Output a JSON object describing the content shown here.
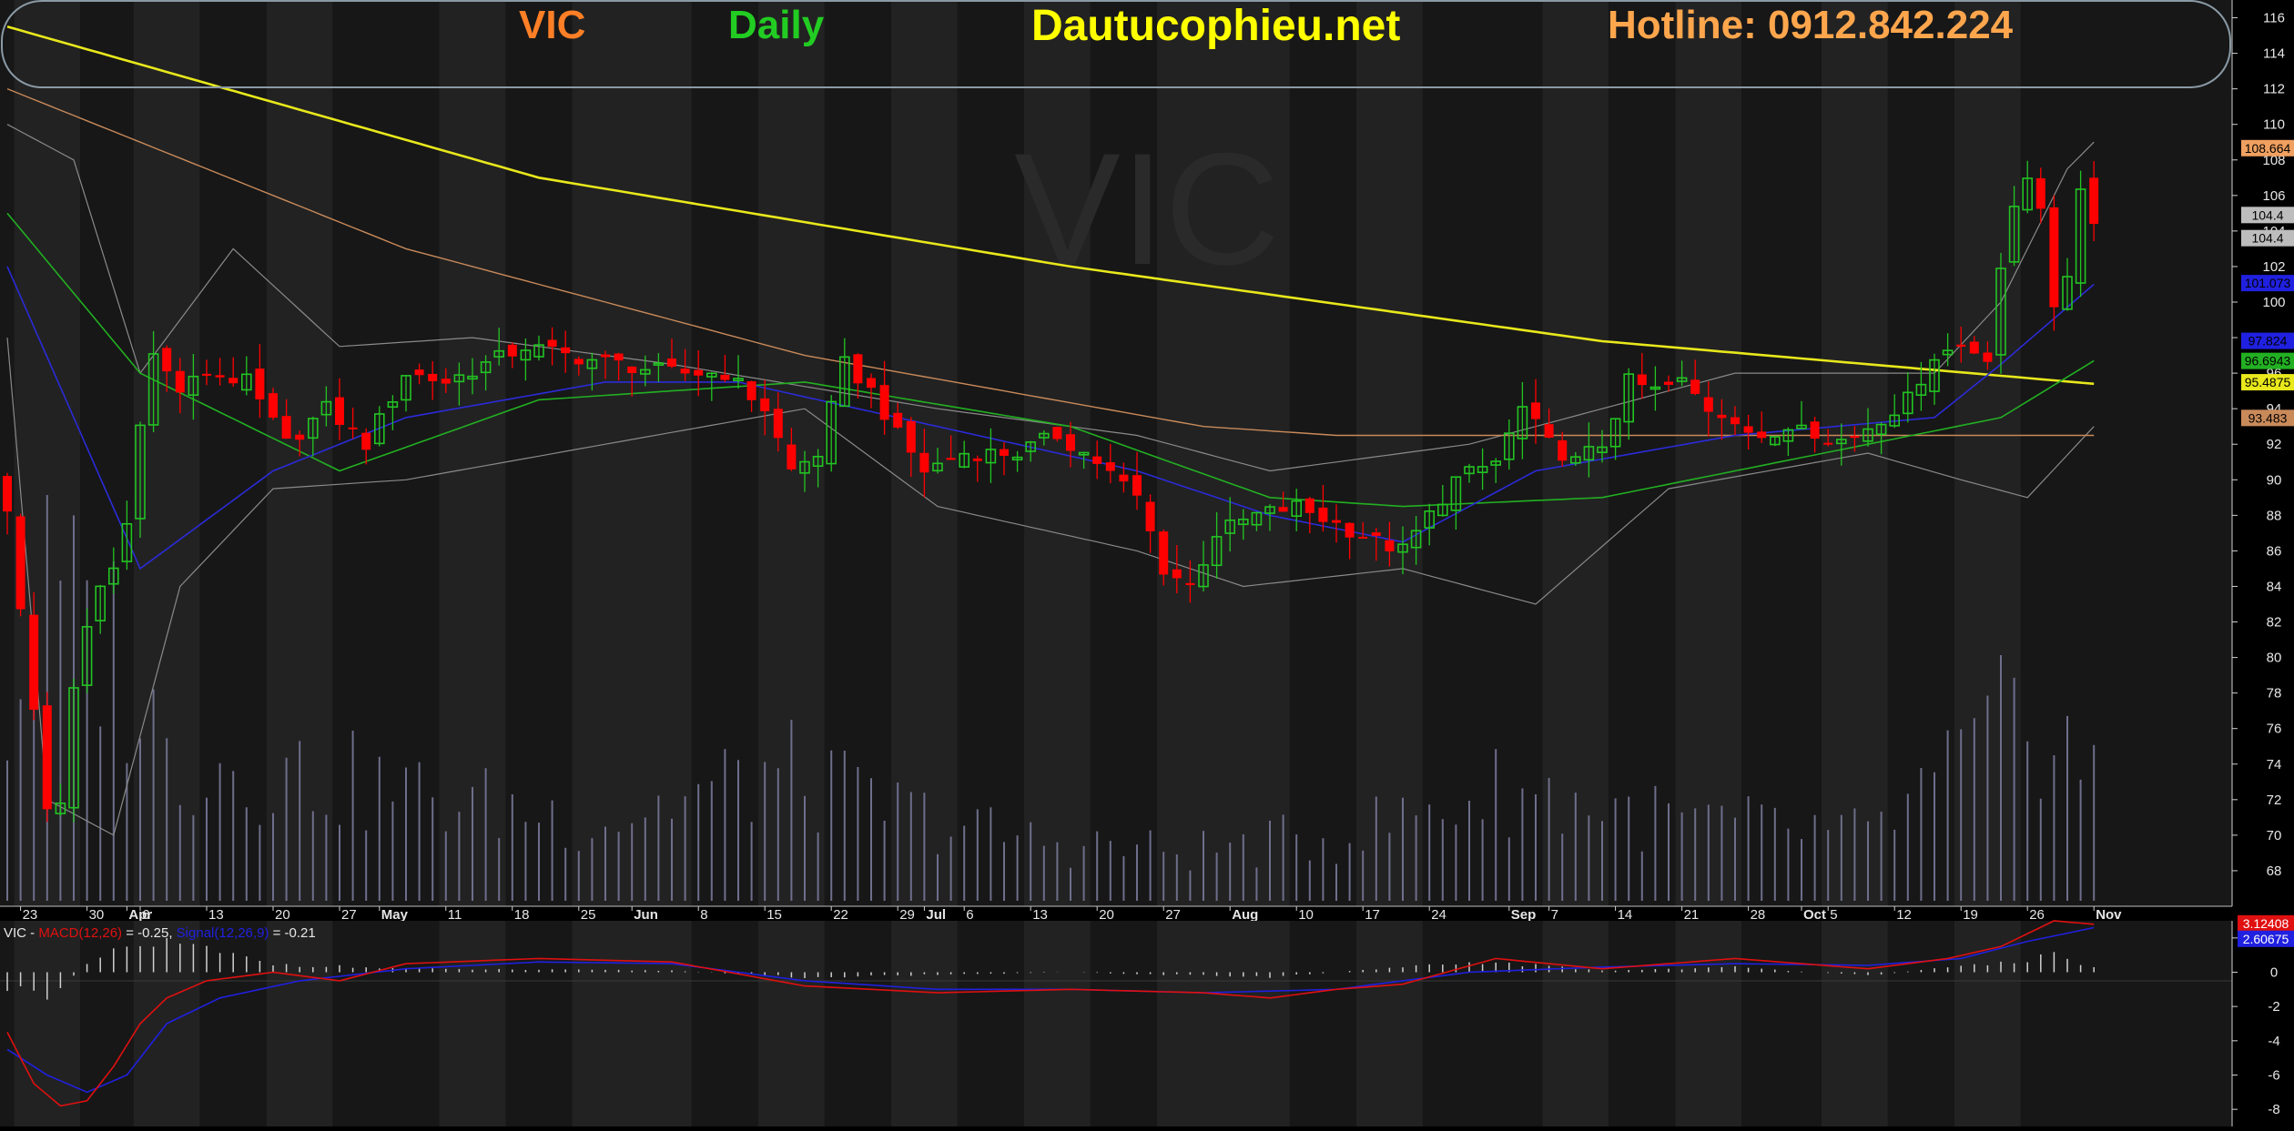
{
  "header": {
    "symbol": "VIC",
    "period": "Daily",
    "site": "Dautucophieu.net",
    "hotline": "Hotline: 0912.842.224"
  },
  "watermark": "VIC",
  "colors": {
    "background": "#000000",
    "panel": "#1a1a1a",
    "band_dark": "#171717",
    "band_light": "#222222",
    "up": "#22c422",
    "down": "#ff0000",
    "ma200": "#e8e81c",
    "ma100": "#c98a5a",
    "ma50": "#22b022",
    "ma20": "#2b2bd9",
    "bollinger": "#8a8a8a",
    "volume": "#6e6e8c",
    "macd": "#e01010",
    "signal": "#2020e0",
    "symbol_text": "#ff7f27",
    "period_text": "#22cc22",
    "site_text": "#ffff00",
    "hotline_text": "#ffa64d"
  },
  "chart_data": [
    {
      "type": "candlestick",
      "title": "VIC",
      "price_axis": {
        "min": 66,
        "max": 117,
        "ticks": [
          68,
          70,
          72,
          74,
          76,
          78,
          80,
          82,
          84,
          86,
          88,
          90,
          92,
          94,
          96,
          98,
          100,
          102,
          104,
          106,
          108,
          110,
          112,
          114,
          116
        ]
      },
      "date_labels": [
        {
          "label": "23",
          "day": 1
        },
        {
          "label": "30",
          "day": 6
        },
        {
          "label": "Apr",
          "day": 9,
          "bold": true
        },
        {
          "label": "6",
          "day": 10
        },
        {
          "label": "13",
          "day": 15
        },
        {
          "label": "20",
          "day": 20
        },
        {
          "label": "27",
          "day": 25
        },
        {
          "label": "May",
          "day": 28,
          "bold": true
        },
        {
          "label": "11",
          "day": 33
        },
        {
          "label": "18",
          "day": 38
        },
        {
          "label": "25",
          "day": 43
        },
        {
          "label": "Jun",
          "day": 47,
          "bold": true
        },
        {
          "label": "8",
          "day": 52
        },
        {
          "label": "15",
          "day": 57
        },
        {
          "label": "22",
          "day": 62
        },
        {
          "label": "29",
          "day": 67
        },
        {
          "label": "Jul",
          "day": 69,
          "bold": true
        },
        {
          "label": "6",
          "day": 72
        },
        {
          "label": "13",
          "day": 77
        },
        {
          "label": "20",
          "day": 82
        },
        {
          "label": "27",
          "day": 87
        },
        {
          "label": "Aug",
          "day": 92,
          "bold": true
        },
        {
          "label": "10",
          "day": 97
        },
        {
          "label": "17",
          "day": 102
        },
        {
          "label": "24",
          "day": 107
        },
        {
          "label": "Sep",
          "day": 113,
          "bold": true
        },
        {
          "label": "7",
          "day": 116
        },
        {
          "label": "14",
          "day": 121
        },
        {
          "label": "21",
          "day": 126
        },
        {
          "label": "28",
          "day": 131
        },
        {
          "label": "Oct",
          "day": 135,
          "bold": true
        },
        {
          "label": "5",
          "day": 137
        },
        {
          "label": "12",
          "day": 142
        },
        {
          "label": "19",
          "day": 147
        },
        {
          "label": "26",
          "day": 152
        },
        {
          "label": "Nov",
          "day": 157,
          "bold": true
        }
      ],
      "price_key_points": [
        {
          "day": 0,
          "close": 88.5
        },
        {
          "day": 1,
          "close": 82.5
        },
        {
          "day": 2,
          "close": 77
        },
        {
          "day": 3,
          "close": 71.5
        },
        {
          "day": 4,
          "close": 72
        },
        {
          "day": 5,
          "close": 78
        },
        {
          "day": 6,
          "close": 81.5
        },
        {
          "day": 7,
          "close": 84
        },
        {
          "day": 8,
          "close": 85
        },
        {
          "day": 9,
          "close": 87.5
        },
        {
          "day": 10,
          "close": 93.5
        },
        {
          "day": 11,
          "close": 97
        },
        {
          "day": 13,
          "close": 95
        },
        {
          "day": 15,
          "close": 96
        },
        {
          "day": 18,
          "close": 95.5
        },
        {
          "day": 21,
          "close": 92
        },
        {
          "day": 24,
          "close": 94
        },
        {
          "day": 27,
          "close": 92
        },
        {
          "day": 30,
          "close": 96
        },
        {
          "day": 33,
          "close": 95.5
        },
        {
          "day": 36,
          "close": 96.5
        },
        {
          "day": 39,
          "close": 97.5
        },
        {
          "day": 42,
          "close": 97
        },
        {
          "day": 46,
          "close": 96.5
        },
        {
          "day": 50,
          "close": 96
        },
        {
          "day": 54,
          "close": 96
        },
        {
          "day": 57,
          "close": 94
        },
        {
          "day": 59,
          "close": 90.5
        },
        {
          "day": 61,
          "close": 91.5
        },
        {
          "day": 63,
          "close": 96.5
        },
        {
          "day": 65,
          "close": 95
        },
        {
          "day": 67,
          "close": 92.5
        },
        {
          "day": 69,
          "close": 90.5
        },
        {
          "day": 72,
          "close": 91.5
        },
        {
          "day": 76,
          "close": 91.5
        },
        {
          "day": 79,
          "close": 92.5
        },
        {
          "day": 82,
          "close": 91
        },
        {
          "day": 85,
          "close": 89
        },
        {
          "day": 87,
          "close": 85
        },
        {
          "day": 89,
          "close": 84
        },
        {
          "day": 91,
          "close": 87
        },
        {
          "day": 94,
          "close": 88
        },
        {
          "day": 97,
          "close": 88.5
        },
        {
          "day": 100,
          "close": 87.5
        },
        {
          "day": 103,
          "close": 86.5
        },
        {
          "day": 105,
          "close": 86
        },
        {
          "day": 107,
          "close": 88
        },
        {
          "day": 109,
          "close": 90
        },
        {
          "day": 112,
          "close": 91
        },
        {
          "day": 114,
          "close": 94
        },
        {
          "day": 116,
          "close": 92
        },
        {
          "day": 118,
          "close": 91
        },
        {
          "day": 120,
          "close": 92
        },
        {
          "day": 122,
          "close": 95.5
        },
        {
          "day": 124,
          "close": 95
        },
        {
          "day": 126,
          "close": 95.5
        },
        {
          "day": 128,
          "close": 94
        },
        {
          "day": 130,
          "close": 93.5
        },
        {
          "day": 132,
          "close": 92
        },
        {
          "day": 135,
          "close": 93.5
        },
        {
          "day": 137,
          "close": 92
        },
        {
          "day": 139,
          "close": 92.5
        },
        {
          "day": 141,
          "close": 93.5
        },
        {
          "day": 143,
          "close": 94.5
        },
        {
          "day": 145,
          "close": 97
        },
        {
          "day": 147,
          "close": 97.5
        },
        {
          "day": 149,
          "close": 97
        },
        {
          "day": 150,
          "close": 102
        },
        {
          "day": 151,
          "close": 105
        },
        {
          "day": 152,
          "close": 107
        },
        {
          "day": 153,
          "close": 105.5
        },
        {
          "day": 154,
          "close": 100
        },
        {
          "day": 155,
          "close": 101
        },
        {
          "day": 156,
          "close": 106.5
        },
        {
          "day": 157,
          "close": 104.4
        }
      ],
      "last_candle": {
        "open": 107,
        "close": 104.4
      },
      "series": [
        {
          "name": "MA200",
          "key_points": [
            [
              0,
              115.5
            ],
            [
              40,
              107
            ],
            [
              80,
              102
            ],
            [
              120,
              97.8
            ],
            [
              157,
              95.4
            ]
          ]
        },
        {
          "name": "MA100",
          "key_points": [
            [
              0,
              112
            ],
            [
              30,
              103
            ],
            [
              60,
              97
            ],
            [
              90,
              93
            ],
            [
              100,
              92.5
            ],
            [
              130,
              92.5
            ],
            [
              157,
              92.5
            ]
          ]
        },
        {
          "name": "MA50",
          "key_points": [
            [
              0,
              105
            ],
            [
              10,
              96
            ],
            [
              25,
              90.5
            ],
            [
              40,
              94.5
            ],
            [
              60,
              95.5
            ],
            [
              80,
              93
            ],
            [
              95,
              89
            ],
            [
              105,
              88.5
            ],
            [
              120,
              89
            ],
            [
              140,
              92
            ],
            [
              150,
              93.5
            ],
            [
              157,
              96.7
            ]
          ]
        },
        {
          "name": "MA20",
          "key_points": [
            [
              0,
              102
            ],
            [
              10,
              85
            ],
            [
              20,
              90.5
            ],
            [
              30,
              93.5
            ],
            [
              45,
              95.5
            ],
            [
              55,
              95.5
            ],
            [
              70,
              93
            ],
            [
              85,
              90.5
            ],
            [
              95,
              88
            ],
            [
              105,
              86.5
            ],
            [
              115,
              90.5
            ],
            [
              130,
              92.5
            ],
            [
              145,
              93.5
            ],
            [
              150,
              96.5
            ],
            [
              157,
              101
            ]
          ]
        }
      ],
      "bollinger_upper": [
        [
          0,
          110
        ],
        [
          5,
          108
        ],
        [
          10,
          96
        ],
        [
          17,
          103
        ],
        [
          25,
          97.5
        ],
        [
          35,
          98
        ],
        [
          50,
          96.5
        ],
        [
          70,
          94
        ],
        [
          85,
          92.5
        ],
        [
          95,
          90.5
        ],
        [
          110,
          92
        ],
        [
          120,
          94
        ],
        [
          130,
          96
        ],
        [
          145,
          96
        ],
        [
          150,
          100
        ],
        [
          155,
          107.5
        ],
        [
          157,
          109
        ]
      ],
      "bollinger_lower": [
        [
          0,
          98
        ],
        [
          3,
          72
        ],
        [
          8,
          70
        ],
        [
          13,
          84
        ],
        [
          20,
          89.5
        ],
        [
          30,
          90
        ],
        [
          45,
          92
        ],
        [
          60,
          94
        ],
        [
          70,
          88.5
        ],
        [
          85,
          86
        ],
        [
          93,
          84
        ],
        [
          105,
          85
        ],
        [
          115,
          83
        ],
        [
          125,
          89.5
        ],
        [
          140,
          91.5
        ],
        [
          147,
          90
        ],
        [
          152,
          89
        ],
        [
          157,
          93
        ]
      ],
      "volume_key_points": [
        [
          0,
          0.55
        ],
        [
          3,
          0.92
        ],
        [
          8,
          0.8
        ],
        [
          12,
          0.45
        ],
        [
          18,
          0.42
        ],
        [
          28,
          0.35
        ],
        [
          35,
          0.3
        ],
        [
          45,
          0.25
        ],
        [
          58,
          0.4
        ],
        [
          65,
          0.3
        ],
        [
          75,
          0.2
        ],
        [
          88,
          0.15
        ],
        [
          100,
          0.2
        ],
        [
          113,
          0.35
        ],
        [
          125,
          0.25
        ],
        [
          140,
          0.2
        ],
        [
          148,
          0.45
        ],
        [
          152,
          0.6
        ],
        [
          157,
          0.4
        ]
      ],
      "price_labels": [
        {
          "text": "108.664",
          "value": 108.664,
          "color": "#f0a060"
        },
        {
          "text": "104.4",
          "value": 104.9,
          "color": "#bdbdbd"
        },
        {
          "text": "104.4",
          "value": 103.6,
          "color": "#bdbdbd"
        },
        {
          "text": "101.073",
          "value": 101.07,
          "color": "#2020e0"
        },
        {
          "text": "97.824",
          "value": 97.82,
          "color": "#2020e0"
        },
        {
          "text": "96.6943",
          "value": 96.69,
          "color": "#22b022"
        },
        {
          "text": "95.4875",
          "value": 95.49,
          "color": "#e8e81c"
        },
        {
          "text": "93.483",
          "value": 93.48,
          "color": "#c98a5a"
        }
      ]
    },
    {
      "type": "line",
      "title": "VIC - MACD(12,26) = -0.25, Signal(12,26,9) = -0.21",
      "legend": {
        "prefix": "VIC - ",
        "macd_label": "MACD(12,26)",
        "macd_value": " = -0.25, ",
        "signal_label": "Signal(12,26,9)",
        "signal_value": " = -0.21"
      },
      "y_axis": {
        "min": -9,
        "max": 3,
        "ticks": [
          2,
          0,
          -2,
          -4,
          -6,
          -8
        ]
      },
      "macd_key_points": [
        [
          0,
          -3.5
        ],
        [
          2,
          -6.5
        ],
        [
          4,
          -7.8
        ],
        [
          6,
          -7.5
        ],
        [
          8,
          -5.5
        ],
        [
          10,
          -3
        ],
        [
          12,
          -1.5
        ],
        [
          15,
          -0.5
        ],
        [
          20,
          0
        ],
        [
          25,
          -0.5
        ],
        [
          30,
          0.5
        ],
        [
          40,
          0.8
        ],
        [
          50,
          0.6
        ],
        [
          60,
          -0.8
        ],
        [
          70,
          -1.2
        ],
        [
          80,
          -1
        ],
        [
          90,
          -1.2
        ],
        [
          95,
          -1.5
        ],
        [
          100,
          -1
        ],
        [
          105,
          -0.7
        ],
        [
          112,
          0.8
        ],
        [
          120,
          0.2
        ],
        [
          130,
          0.8
        ],
        [
          140,
          0.2
        ],
        [
          146,
          0.8
        ],
        [
          150,
          1.5
        ],
        [
          154,
          3
        ],
        [
          157,
          2.8
        ]
      ],
      "signal_key_points": [
        [
          0,
          -4.5
        ],
        [
          3,
          -6
        ],
        [
          6,
          -7
        ],
        [
          9,
          -6
        ],
        [
          12,
          -3
        ],
        [
          16,
          -1.5
        ],
        [
          22,
          -0.5
        ],
        [
          30,
          0.2
        ],
        [
          40,
          0.6
        ],
        [
          50,
          0.5
        ],
        [
          60,
          -0.5
        ],
        [
          70,
          -1
        ],
        [
          80,
          -1
        ],
        [
          90,
          -1.2
        ],
        [
          100,
          -1
        ],
        [
          110,
          0
        ],
        [
          120,
          0.3
        ],
        [
          130,
          0.5
        ],
        [
          140,
          0.4
        ],
        [
          147,
          0.8
        ],
        [
          152,
          1.8
        ],
        [
          157,
          2.6
        ]
      ],
      "histogram_key_points": [
        [
          0,
          -1
        ],
        [
          3,
          -1.5
        ],
        [
          6,
          0.5
        ],
        [
          9,
          1.5
        ],
        [
          12,
          1.8
        ],
        [
          16,
          1.2
        ],
        [
          20,
          0.5
        ],
        [
          30,
          0.2
        ],
        [
          50,
          0.1
        ],
        [
          60,
          -0.3
        ],
        [
          80,
          0
        ],
        [
          95,
          -0.3
        ],
        [
          105,
          0.3
        ],
        [
          112,
          0.6
        ],
        [
          120,
          0.1
        ],
        [
          130,
          0.3
        ],
        [
          140,
          -0.2
        ],
        [
          150,
          0.6
        ],
        [
          154,
          1
        ],
        [
          157,
          0.3
        ]
      ],
      "value_labels": [
        {
          "text": "3.12408",
          "value": 2.85,
          "color": "#e01010"
        },
        {
          "text": "2.60675",
          "value": 1.95,
          "color": "#2020e0"
        }
      ]
    }
  ]
}
